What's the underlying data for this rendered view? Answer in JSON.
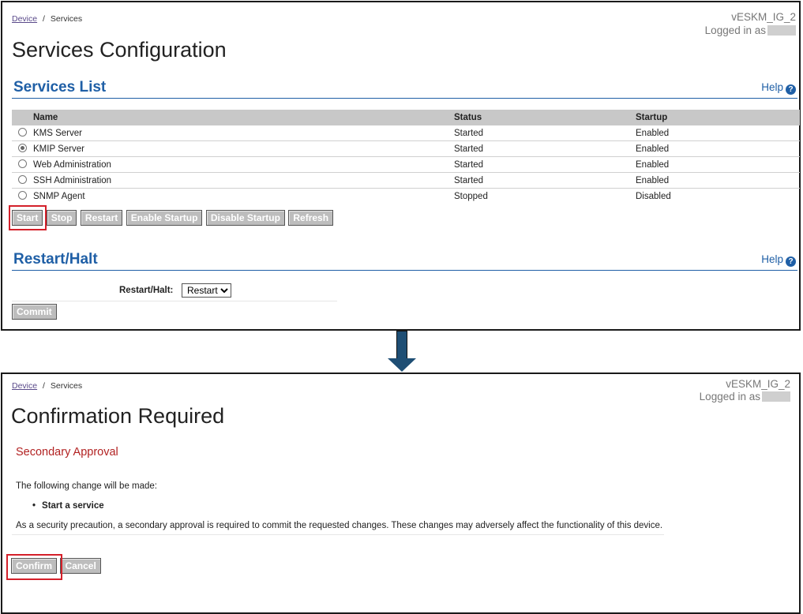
{
  "panel1": {
    "breadcrumb": {
      "link": "Device",
      "sep": "/",
      "current": "Services"
    },
    "device_name": "vESKM_IG_2",
    "logged_in_label": "Logged in as",
    "title": "Services Configuration",
    "services_section": {
      "title": "Services List",
      "help": "Help"
    },
    "table": {
      "headers": [
        "Name",
        "Status",
        "Startup"
      ],
      "rows": [
        {
          "name": "KMS Server",
          "status": "Started",
          "startup": "Enabled",
          "selected": false
        },
        {
          "name": "KMIP Server",
          "status": "Started",
          "startup": "Enabled",
          "selected": true
        },
        {
          "name": "Web Administration",
          "status": "Started",
          "startup": "Enabled",
          "selected": false
        },
        {
          "name": "SSH Administration",
          "status": "Started",
          "startup": "Enabled",
          "selected": false
        },
        {
          "name": "SNMP Agent",
          "status": "Stopped",
          "startup": "Disabled",
          "selected": false
        }
      ]
    },
    "buttons": {
      "start": "Start",
      "stop": "Stop",
      "restart": "Restart",
      "enable_startup": "Enable Startup",
      "disable_startup": "Disable Startup",
      "refresh": "Refresh"
    },
    "restart_section": {
      "title": "Restart/Halt",
      "help": "Help",
      "field_label": "Restart/Halt:",
      "select_value": "Restart",
      "commit": "Commit"
    }
  },
  "panel2": {
    "breadcrumb": {
      "link": "Device",
      "sep": "/",
      "current": "Services"
    },
    "device_name": "vESKM_IG_2",
    "logged_in_label": "Logged in as",
    "title": "Confirmation Required",
    "approval_title": "Secondary Approval",
    "intro": "The following change will be made:",
    "change_item": "Start a service",
    "warning": "As a security precaution, a secondary approval is required to commit the requested changes.  These changes may adversely affect the functionality of this device.",
    "buttons": {
      "confirm": "Confirm",
      "cancel": "Cancel"
    }
  },
  "colors": {
    "section_blue": "#1f5fa6",
    "approval_red": "#b22222",
    "highlight_red": "#d4202a",
    "arrow": "#1e4e74",
    "button_gray": "#bdbdbd"
  }
}
